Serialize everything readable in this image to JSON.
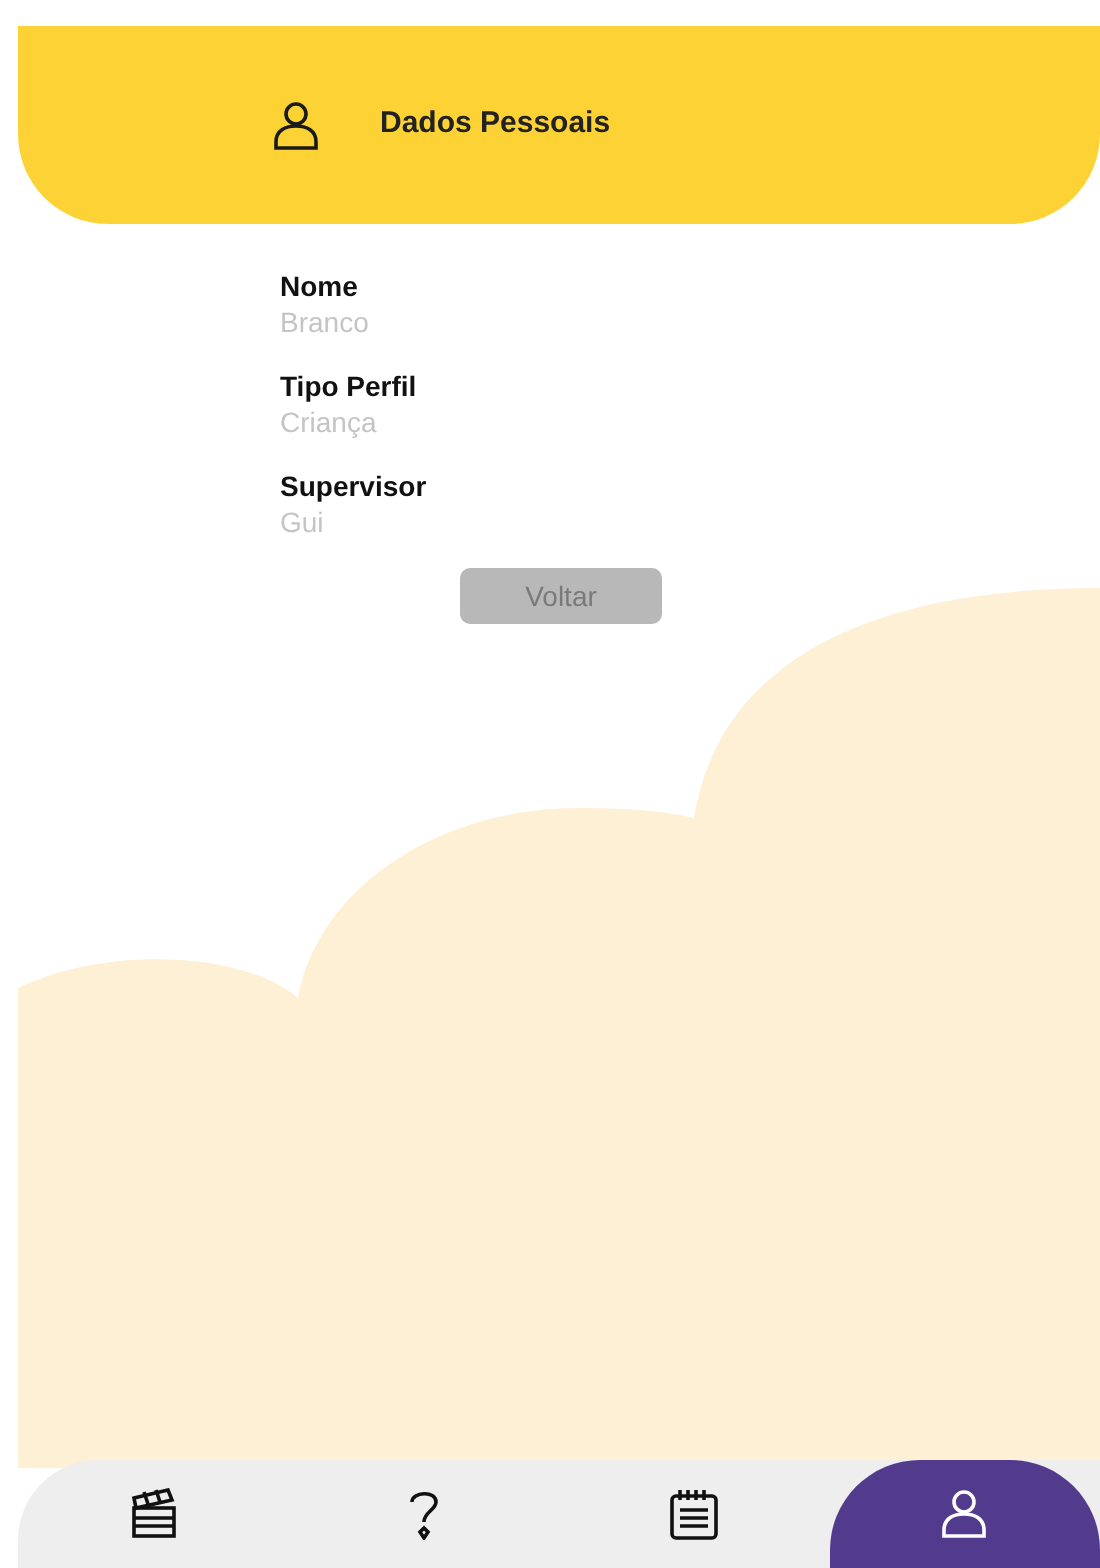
{
  "header": {
    "title": "Dados Pessoais"
  },
  "fields": [
    {
      "label": "Nome",
      "value": "Branco"
    },
    {
      "label": "Tipo Perfil",
      "value": "Criança"
    },
    {
      "label": "Supervisor",
      "value": "Gui"
    }
  ],
  "back_button": {
    "label": "Voltar"
  },
  "nav": [
    {
      "kind": "clapper",
      "selected": false
    },
    {
      "kind": "help",
      "selected": false
    },
    {
      "kind": "calendar",
      "selected": false
    },
    {
      "kind": "profile",
      "selected": true
    }
  ]
}
